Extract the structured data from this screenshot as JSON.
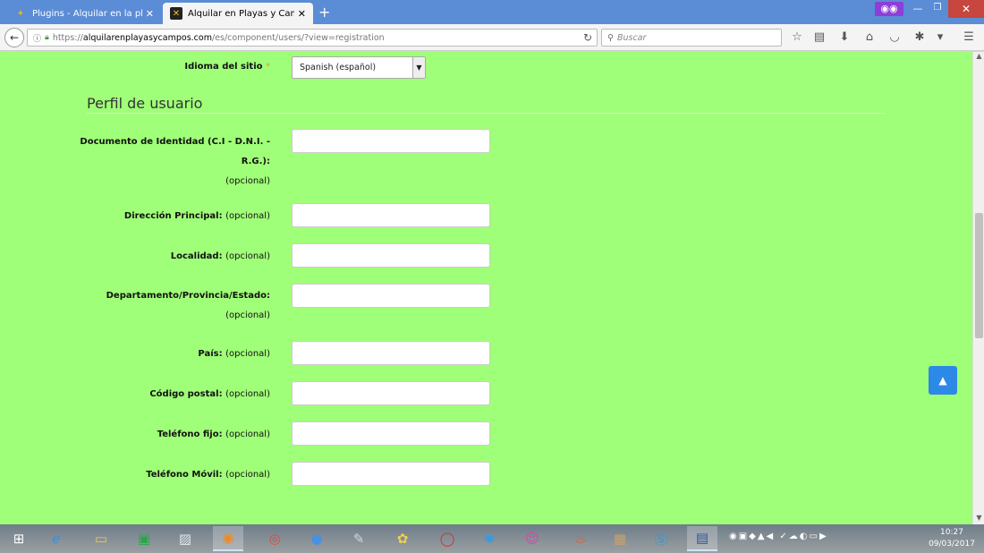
{
  "browser": {
    "tabs": [
      {
        "label": "Plugins - Alquilar en la pla...",
        "active": false,
        "icon": "joomla-icon"
      },
      {
        "label": "Alquilar en Playas y Camp...",
        "active": true,
        "icon": "site-icon"
      }
    ],
    "url": {
      "prefix": "https://",
      "domain": "alquilarenplayasycampos.com",
      "path": "/es/component/users/?view=registration"
    },
    "search_placeholder": "Buscar"
  },
  "form": {
    "language": {
      "label": "Idioma del sitio",
      "required_mark": "*",
      "value": "Spanish (español)"
    },
    "section_title": "Perfil de usuario",
    "fields": [
      {
        "label_line1": "Documento de Identidad (C.I - D.N.I. -",
        "label_line2": "R.G.):",
        "optional": "(opcional)"
      },
      {
        "label": "Dirección Principal:",
        "optional": "(opcional)"
      },
      {
        "label": "Localidad:",
        "optional": "(opcional)"
      },
      {
        "label_line1": "Departamento/Provincia/Estado:",
        "optional": "(opcional)"
      },
      {
        "label": "País:",
        "optional": "(opcional)"
      },
      {
        "label": "Código postal:",
        "optional": "(opcional)"
      },
      {
        "label": "Teléfono fijo:",
        "optional": "(opcional)"
      },
      {
        "label": "Teléfono Móvil:",
        "optional": "(opcional)"
      }
    ]
  },
  "taskbar": {
    "apps": [
      "windows-start-icon",
      "edge-icon",
      "file-explorer-icon",
      "store-icon",
      "image-viewer-icon",
      "firefox-icon",
      "chrome-icon",
      "google-earth-icon",
      "app-icon",
      "picasa-icon",
      "opera-icon",
      "settings-icon",
      "app-icon-2",
      "ccleaner-icon",
      "archive-icon",
      "skype-icon",
      "document-icon"
    ],
    "time": "10:27",
    "date": "09/03/2017"
  }
}
